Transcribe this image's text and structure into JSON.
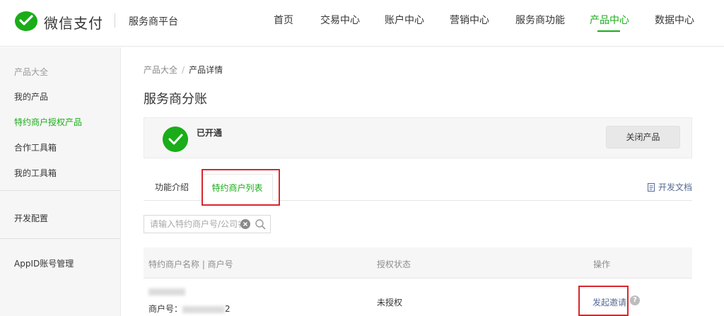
{
  "header": {
    "logo_text": "微信支付",
    "platform": "服务商平台",
    "nav": [
      "首页",
      "交易中心",
      "账户中心",
      "营销中心",
      "服务商功能",
      "产品中心",
      "数据中心"
    ],
    "active_nav": "产品中心",
    "accent_color": "#1aad19"
  },
  "sidebar": {
    "group_title": "产品大全",
    "items": [
      "我的产品",
      "特约商户授权产品",
      "合作工具箱",
      "我的工具箱"
    ],
    "active_item": "特约商户授权产品",
    "dev_config": "开发配置",
    "appid": "AppID账号管理"
  },
  "breadcrumb": {
    "root": "产品大全",
    "separator": "/",
    "current": "产品详情"
  },
  "page_title": "服务商分账",
  "status": {
    "text": "已开通",
    "button": "关闭产品"
  },
  "tabs": {
    "items": [
      "功能介绍",
      "特约商户列表"
    ],
    "active": "特约商户列表",
    "dev_doc": "开发文档"
  },
  "search": {
    "placeholder": "请输入特约商户号/公司名称"
  },
  "table": {
    "headers": [
      "特约商户名称 | 商户号",
      "授权状态",
      "操作"
    ],
    "rows": [
      {
        "merchant_id_label": "商户号：",
        "merchant_id_tail": "2",
        "auth_status": "未授权",
        "action": "发起邀请",
        "help": "?"
      }
    ]
  },
  "highlight_color": "#d9262c"
}
